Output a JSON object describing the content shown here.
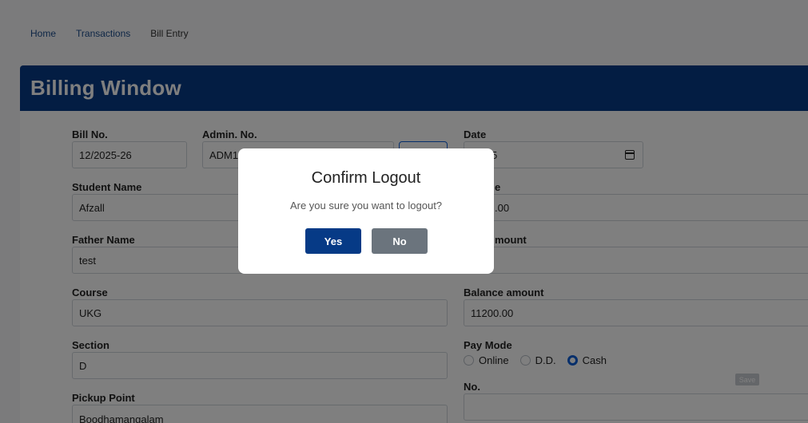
{
  "breadcrumb": {
    "home": "Home",
    "transactions": "Transactions",
    "current": "Bill Entry"
  },
  "card": {
    "title": "Billing Window"
  },
  "form": {
    "bill_no_label": "Bill No.",
    "bill_no_value": "12/2025-26",
    "admin_no_label": "Admin. No.",
    "admin_no_value": "ADM1",
    "date_label": "Date",
    "date_value": "-2025",
    "student_name_label": "Student Name",
    "student_name_value": "Afzall",
    "fee_label_partial": "e",
    "fee_value_partial": ".00",
    "father_name_label": "Father Name",
    "father_name_value": "test",
    "amount_label_partial": "mount",
    "course_label": "Course",
    "course_value": "UKG",
    "balance_label": "Balance amount",
    "balance_value": "11200.00",
    "section_label": "Section",
    "section_value": "D",
    "pay_mode_label": "Pay Mode",
    "pay_modes": [
      "Online",
      "D.D.",
      "Cash"
    ],
    "pay_mode_selected": "Cash",
    "no_label": "No.",
    "pickup_label": "Pickup Point",
    "pickup_value": "Boodhamangalam",
    "save_label": "Save"
  },
  "modal": {
    "title": "Confirm Logout",
    "message": "Are you sure you want to logout?",
    "yes_label": "Yes",
    "no_label": "No"
  },
  "colors": {
    "header": "#063a86",
    "yes_button": "#063a86",
    "no_button": "#6b747d",
    "radio_accent": "#0d5fd6"
  }
}
